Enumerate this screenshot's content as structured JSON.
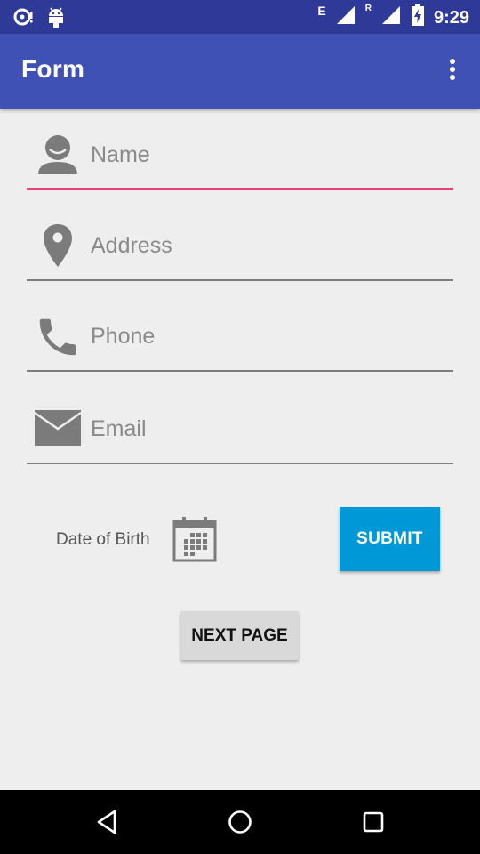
{
  "status_bar": {
    "time": "9:29",
    "network_letter": "E",
    "roaming_letter": "R",
    "left_icons": [
      "sync-icon",
      "android-icon"
    ],
    "right_icons": [
      "signal-icon",
      "roaming-signal-icon",
      "battery-charging-icon"
    ]
  },
  "app_bar": {
    "title": "Form",
    "overflow_icon": "more-vert-icon",
    "color": "#3f51b5"
  },
  "form": {
    "fields": [
      {
        "placeholder": "Name",
        "value": "",
        "icon": "person-icon",
        "focused": true
      },
      {
        "placeholder": "Address",
        "value": "",
        "icon": "location-pin-icon",
        "focused": false
      },
      {
        "placeholder": "Phone",
        "value": "",
        "icon": "phone-icon",
        "focused": false
      },
      {
        "placeholder": "Email",
        "value": "",
        "icon": "email-icon",
        "focused": false
      }
    ],
    "dob_label": "Date of Birth",
    "calendar_icon": "calendar-icon",
    "submit_label": "SUBMIT",
    "next_label": "NEXT PAGE",
    "accent_color": "#ea3d77",
    "submit_color": "#0098d6"
  },
  "nav_bar": {
    "buttons": [
      "back-icon",
      "home-icon",
      "recents-icon"
    ]
  }
}
